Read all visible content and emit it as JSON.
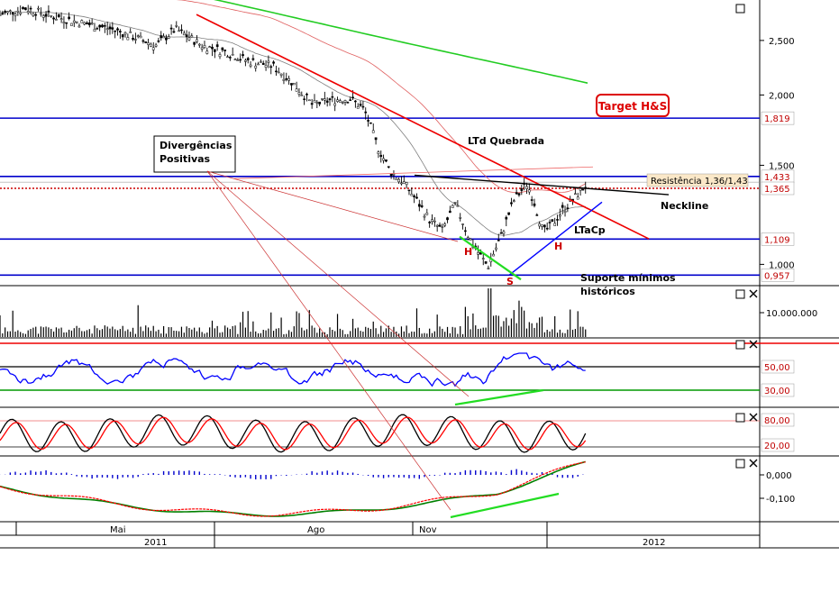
{
  "chart_data": {
    "type": "candlestick",
    "subtype": "technical-analysis",
    "price_axis": {
      "scale": "log",
      "ticks": [
        "2,500",
        "2,000",
        "1,500",
        "1,000"
      ],
      "tick_values": [
        2.5,
        2.0,
        1.5,
        1.0
      ],
      "ylim": [
        0.92,
        2.95
      ],
      "level_tags": [
        {
          "value": 1.819,
          "label": "1,819",
          "color": "#c00000"
        },
        {
          "value": 1.433,
          "label": "1,433",
          "color": "#c00000"
        },
        {
          "value": 1.365,
          "label": "1,365",
          "color": "#c00000"
        },
        {
          "value": 1.109,
          "label": "1,109",
          "color": "#c00000"
        },
        {
          "value": 0.957,
          "label": "0,957",
          "color": "#c00000"
        }
      ]
    },
    "time_axis": {
      "month_labels": [
        "Mai",
        "Ago",
        "Nov"
      ],
      "year_labels": [
        "2011",
        "2012"
      ]
    },
    "horizontal_levels": [
      {
        "value": 1.819,
        "color": "#0000cc",
        "style": "solid"
      },
      {
        "value": 1.433,
        "color": "#0000cc",
        "style": "solid"
      },
      {
        "value": 1.365,
        "color": "#cc0000",
        "style": "dotted"
      },
      {
        "value": 1.109,
        "color": "#0000cc",
        "style": "solid"
      },
      {
        "value": 0.957,
        "color": "#0000cc",
        "style": "solid"
      }
    ],
    "annotations": {
      "target": "Target H&S",
      "ltd": "LTd Quebrada",
      "divergence_line1": "Divergências",
      "divergence_line2": "Positivas",
      "resistance": "Resistência 1,36/1,43",
      "neckline": "Neckline",
      "ltacp": "LTaCp",
      "head_left": "H",
      "head_right": "H",
      "shoulder": "S",
      "support_line1": "Suporte  mínimos",
      "support_line2": "históricos"
    },
    "panels": {
      "volume": {
        "tick": "10.000.000"
      },
      "rsi": {
        "levels": [
          "50,00",
          "30,00"
        ]
      },
      "stochastic": {
        "levels": [
          "80,00",
          "20,00"
        ]
      },
      "macd": {
        "ticks": [
          "0,000",
          "-0,100"
        ]
      }
    },
    "series_colors": {
      "ma_short": "#808080",
      "ma_mid": "#e06060",
      "ma_long": "#22cc22",
      "rsi": "#0000ff",
      "stoch_k": "#000000",
      "stoch_d": "#ff0000",
      "macd": "#ff0000",
      "macd_signal": "#008000",
      "histogram": "#0000cc"
    },
    "price_path_points": [
      [
        0,
        2.78
      ],
      [
        0.04,
        2.85
      ],
      [
        0.08,
        2.76
      ],
      [
        0.13,
        2.68
      ],
      [
        0.17,
        2.62
      ],
      [
        0.2,
        2.55
      ],
      [
        0.24,
        2.45
      ],
      [
        0.27,
        2.62
      ],
      [
        0.31,
        2.45
      ],
      [
        0.35,
        2.38
      ],
      [
        0.38,
        2.3
      ],
      [
        0.42,
        2.25
      ],
      [
        0.45,
        2.1
      ],
      [
        0.48,
        1.92
      ],
      [
        0.51,
        1.96
      ],
      [
        0.54,
        1.97
      ],
      [
        0.56,
        1.88
      ],
      [
        0.58,
        1.62
      ],
      [
        0.6,
        1.46
      ],
      [
        0.62,
        1.4
      ],
      [
        0.64,
        1.3
      ],
      [
        0.66,
        1.2
      ],
      [
        0.68,
        1.15
      ],
      [
        0.7,
        1.28
      ],
      [
        0.72,
        1.12
      ],
      [
        0.735,
        1.05
      ],
      [
        0.75,
        0.99
      ],
      [
        0.77,
        1.12
      ],
      [
        0.79,
        1.3
      ],
      [
        0.81,
        1.39
      ],
      [
        0.82,
        1.3
      ],
      [
        0.835,
        1.14
      ],
      [
        0.85,
        1.18
      ],
      [
        0.865,
        1.25
      ],
      [
        0.88,
        1.3
      ],
      [
        0.9,
        1.38
      ]
    ]
  },
  "ui": {
    "square_icon": "□",
    "close_icon": "✕"
  }
}
